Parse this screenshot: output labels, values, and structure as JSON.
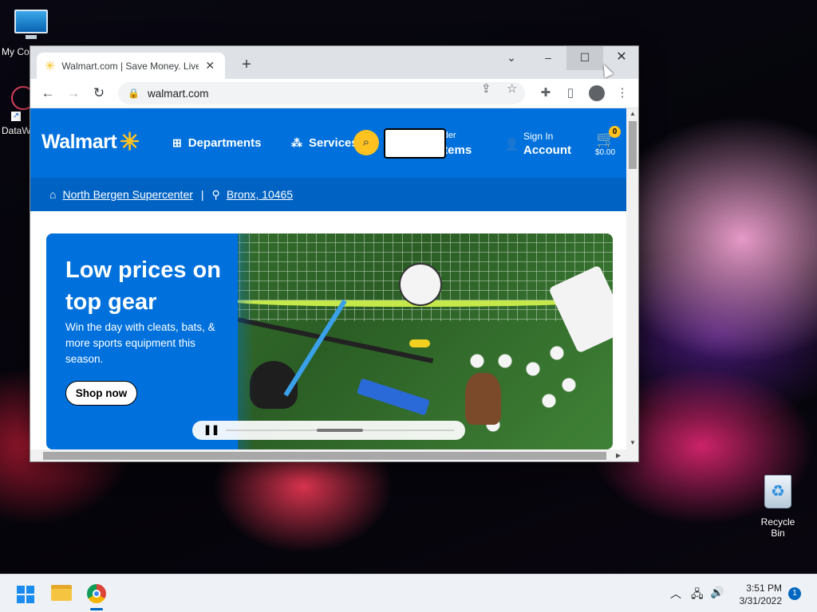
{
  "desktop": {
    "icons": [
      {
        "label": "My Co"
      },
      {
        "label": "DataW"
      },
      {
        "label": "Recycle Bin"
      }
    ]
  },
  "browser": {
    "tab_title": "Walmart.com | Save Money. Live",
    "new_tab": "+",
    "url": "walmart.com",
    "controls": {
      "minimize": "–",
      "maximize": "☐",
      "close": "✕",
      "tab_search": "⌄"
    }
  },
  "walmart": {
    "logo": "Walmart",
    "departments": "Departments",
    "services": "Services",
    "reorder_small": "rder",
    "reorder_big": "Items",
    "signin_small": "Sign In",
    "signin_big": "Account",
    "cart_count": "0",
    "cart_total": "$0.00",
    "store": "North Bergen Supercenter",
    "zip": "Bronx, 10465",
    "hero": {
      "title": "Low prices on top gear",
      "subtitle": "Win the day with cleats, bats, & more sports equipment this season.",
      "cta": "Shop now"
    },
    "accent": "#0071dc",
    "spark_color": "#ffc220"
  },
  "taskbar": {
    "time": "3:51 PM",
    "date": "3/31/2022",
    "notifications": "1"
  }
}
